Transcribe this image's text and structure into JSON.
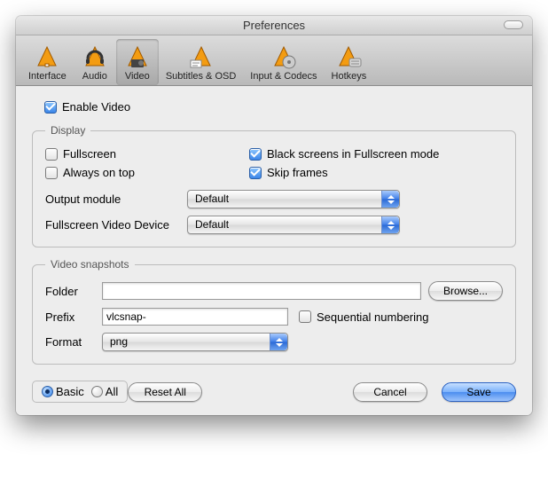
{
  "window": {
    "title": "Preferences"
  },
  "toolbar": {
    "items": [
      {
        "label": "Interface"
      },
      {
        "label": "Audio"
      },
      {
        "label": "Video"
      },
      {
        "label": "Subtitles & OSD"
      },
      {
        "label": "Input & Codecs"
      },
      {
        "label": "Hotkeys"
      }
    ],
    "selected_index": 2
  },
  "enable_video": {
    "label": "Enable Video",
    "checked": true
  },
  "display": {
    "legend": "Display",
    "fullscreen": {
      "label": "Fullscreen",
      "checked": false
    },
    "black_screens": {
      "label": "Black screens in Fullscreen mode",
      "checked": true
    },
    "always_on_top": {
      "label": "Always on top",
      "checked": false
    },
    "skip_frames": {
      "label": "Skip frames",
      "checked": true
    },
    "output_module": {
      "label": "Output module",
      "value": "Default"
    },
    "fullscreen_device": {
      "label": "Fullscreen Video Device",
      "value": "Default"
    }
  },
  "snapshots": {
    "legend": "Video snapshots",
    "folder": {
      "label": "Folder",
      "value": "",
      "browse": "Browse..."
    },
    "prefix": {
      "label": "Prefix",
      "value": "vlcsnap-"
    },
    "sequential": {
      "label": "Sequential numbering",
      "checked": false
    },
    "format": {
      "label": "Format",
      "value": "png"
    }
  },
  "footer": {
    "mode": {
      "basic": "Basic",
      "all": "All",
      "selected": "basic"
    },
    "reset": "Reset All",
    "cancel": "Cancel",
    "save": "Save"
  }
}
